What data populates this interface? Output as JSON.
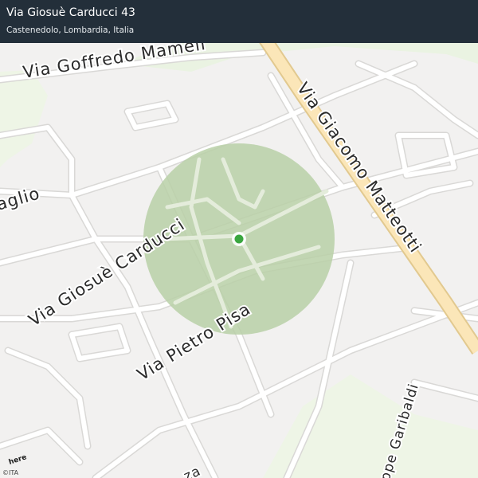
{
  "header": {
    "title": "Via Giosuè Carducci 43",
    "subtitle": "Castenedolo, Lombardia, Italia"
  },
  "map": {
    "road_labels": {
      "mameli": "Via Goffredo Mameli",
      "matteotti": "Via Giacomo Matteotti",
      "carducci": "Via Giosuè Carducci",
      "pisa": "Via Pietro Pisa",
      "maglio": "aglio",
      "garibaldi": "ppe Garibaldi",
      "piazza": "za"
    },
    "colors": {
      "background": "#f2f1f0",
      "road": "#ffffff",
      "road_casing": "#d9d8d6",
      "main_road": "#fbe6b8",
      "main_road_casing": "#e2c98f",
      "radius_fill": "#b9d0a7",
      "marker": "#3aa63f",
      "green_area": "#eaf3e2"
    },
    "marker_icon": "location-dot-icon"
  },
  "attribution": {
    "brand": "here",
    "copyright": "©ITA"
  }
}
